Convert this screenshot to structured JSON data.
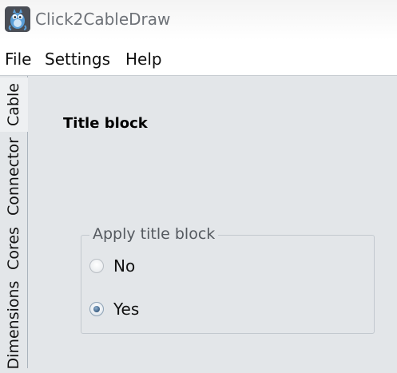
{
  "window": {
    "title": "Click2CableDraw",
    "icon": "app-logo-icon"
  },
  "menu": {
    "items": [
      "File",
      "Settings",
      "Help"
    ]
  },
  "side_tabs": {
    "items": [
      {
        "label": "Cable",
        "active": true
      },
      {
        "label": "Connector",
        "active": false
      },
      {
        "label": "Cores",
        "active": false
      },
      {
        "label": "Dimensions",
        "active": false
      }
    ]
  },
  "content": {
    "title": "Title block",
    "group": {
      "legend": "Apply title block",
      "options": [
        {
          "label": "No",
          "selected": false
        },
        {
          "label": "Yes",
          "selected": true
        }
      ]
    }
  },
  "colors": {
    "background": "#e3e6e9",
    "menubar": "#ffffff",
    "title_text": "#6d7177",
    "radio_selected": "#3b5e82"
  }
}
